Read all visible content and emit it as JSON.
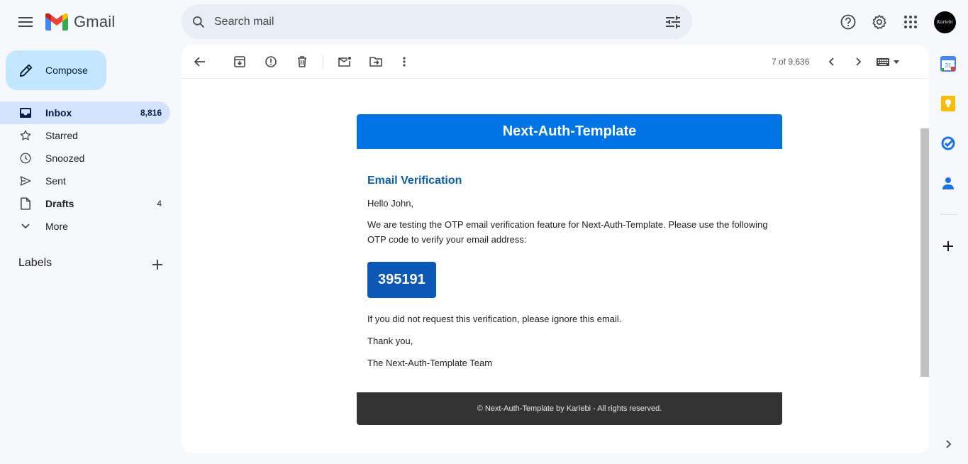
{
  "app": {
    "name": "Gmail"
  },
  "search": {
    "placeholder": "Search mail"
  },
  "account": {
    "avatar_text": "Kariebi"
  },
  "compose": {
    "label": "Compose"
  },
  "sidebar": {
    "items": [
      {
        "label": "Inbox",
        "count": "8,816"
      },
      {
        "label": "Starred",
        "count": ""
      },
      {
        "label": "Snoozed",
        "count": ""
      },
      {
        "label": "Sent",
        "count": ""
      },
      {
        "label": "Drafts",
        "count": "4"
      },
      {
        "label": "More",
        "count": ""
      }
    ],
    "labels_heading": "Labels"
  },
  "toolbar": {
    "pager": "7 of 9,636"
  },
  "email": {
    "header": "Next-Auth-Template",
    "title": "Email Verification",
    "greeting": "Hello John,",
    "intro": "We are testing the OTP email verification feature for Next-Auth-Template. Please use the following OTP code to verify your email address:",
    "otp": "395191",
    "ignore": "If you did not request this verification, please ignore this email.",
    "thanks": "Thank you,",
    "signature": "The Next-Auth-Template Team",
    "footer": "© Next-Auth-Template by Kariebi - All rights reserved."
  },
  "colors": {
    "brand_header": "#0073e6",
    "otp_bg": "#0c58b6",
    "title_text": "#0c5fad",
    "footer_bg": "#333333",
    "compose_bg": "#c2e7ff",
    "active_nav": "#d3e3fd"
  },
  "icons": [
    "menu-icon",
    "gmail-logo-icon",
    "search-icon",
    "tune-icon",
    "help-icon",
    "gear-icon",
    "apps-grid-icon",
    "pencil-icon",
    "inbox-icon",
    "star-icon",
    "clock-icon",
    "send-icon",
    "draft-icon",
    "chevron-down-icon",
    "plus-icon",
    "back-arrow-icon",
    "archive-icon",
    "report-spam-icon",
    "trash-icon",
    "mark-unread-icon",
    "move-to-icon",
    "more-vert-icon",
    "chevron-left-icon",
    "chevron-right-icon",
    "keyboard-icon",
    "calendar-icon",
    "keep-icon",
    "tasks-icon",
    "contacts-icon",
    "chevron-right-small-icon"
  ]
}
